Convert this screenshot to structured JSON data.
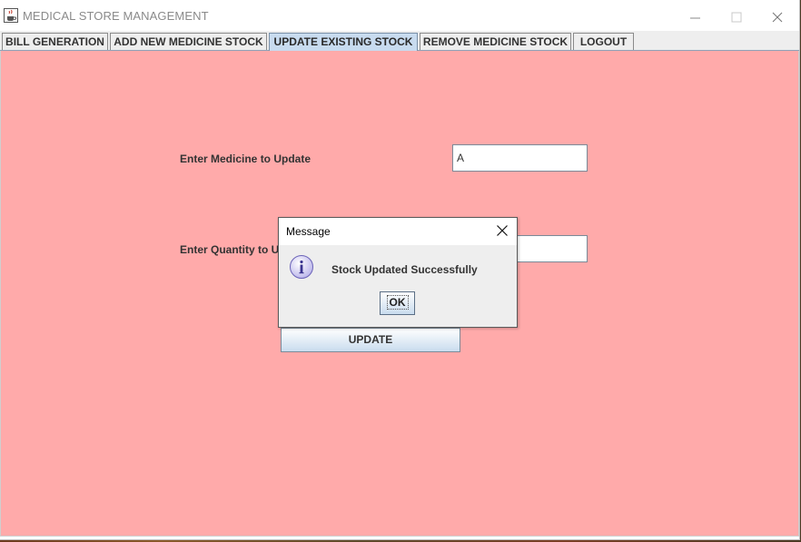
{
  "window": {
    "title": "MEDICAL STORE MANAGEMENT",
    "app_icon": "java-cup-icon",
    "controls": [
      "minimize-icon",
      "maximize-icon",
      "close-icon"
    ]
  },
  "tabs": [
    {
      "label": "BILL GENERATION",
      "active": false
    },
    {
      "label": "ADD NEW MEDICINE STOCK",
      "active": false
    },
    {
      "label": "UPDATE EXISTING STOCK",
      "active": true
    },
    {
      "label": "REMOVE MEDICINE STOCK",
      "active": false
    },
    {
      "label": "LOGOUT",
      "active": false
    }
  ],
  "form": {
    "medicine_label": "Enter Medicine to Update",
    "medicine_value": "A",
    "quantity_label": "Enter Quantity to Up",
    "quantity_value": "",
    "update_button": "UPDATE"
  },
  "dialog": {
    "title": "Message",
    "message": "Stock Updated Successfully",
    "ok_button": "OK",
    "icon": "info-icon"
  },
  "colors": {
    "panel_background": "#ffaaaa",
    "active_tab": "#c8dbef",
    "button_gradient_end": "#c9dcee"
  }
}
